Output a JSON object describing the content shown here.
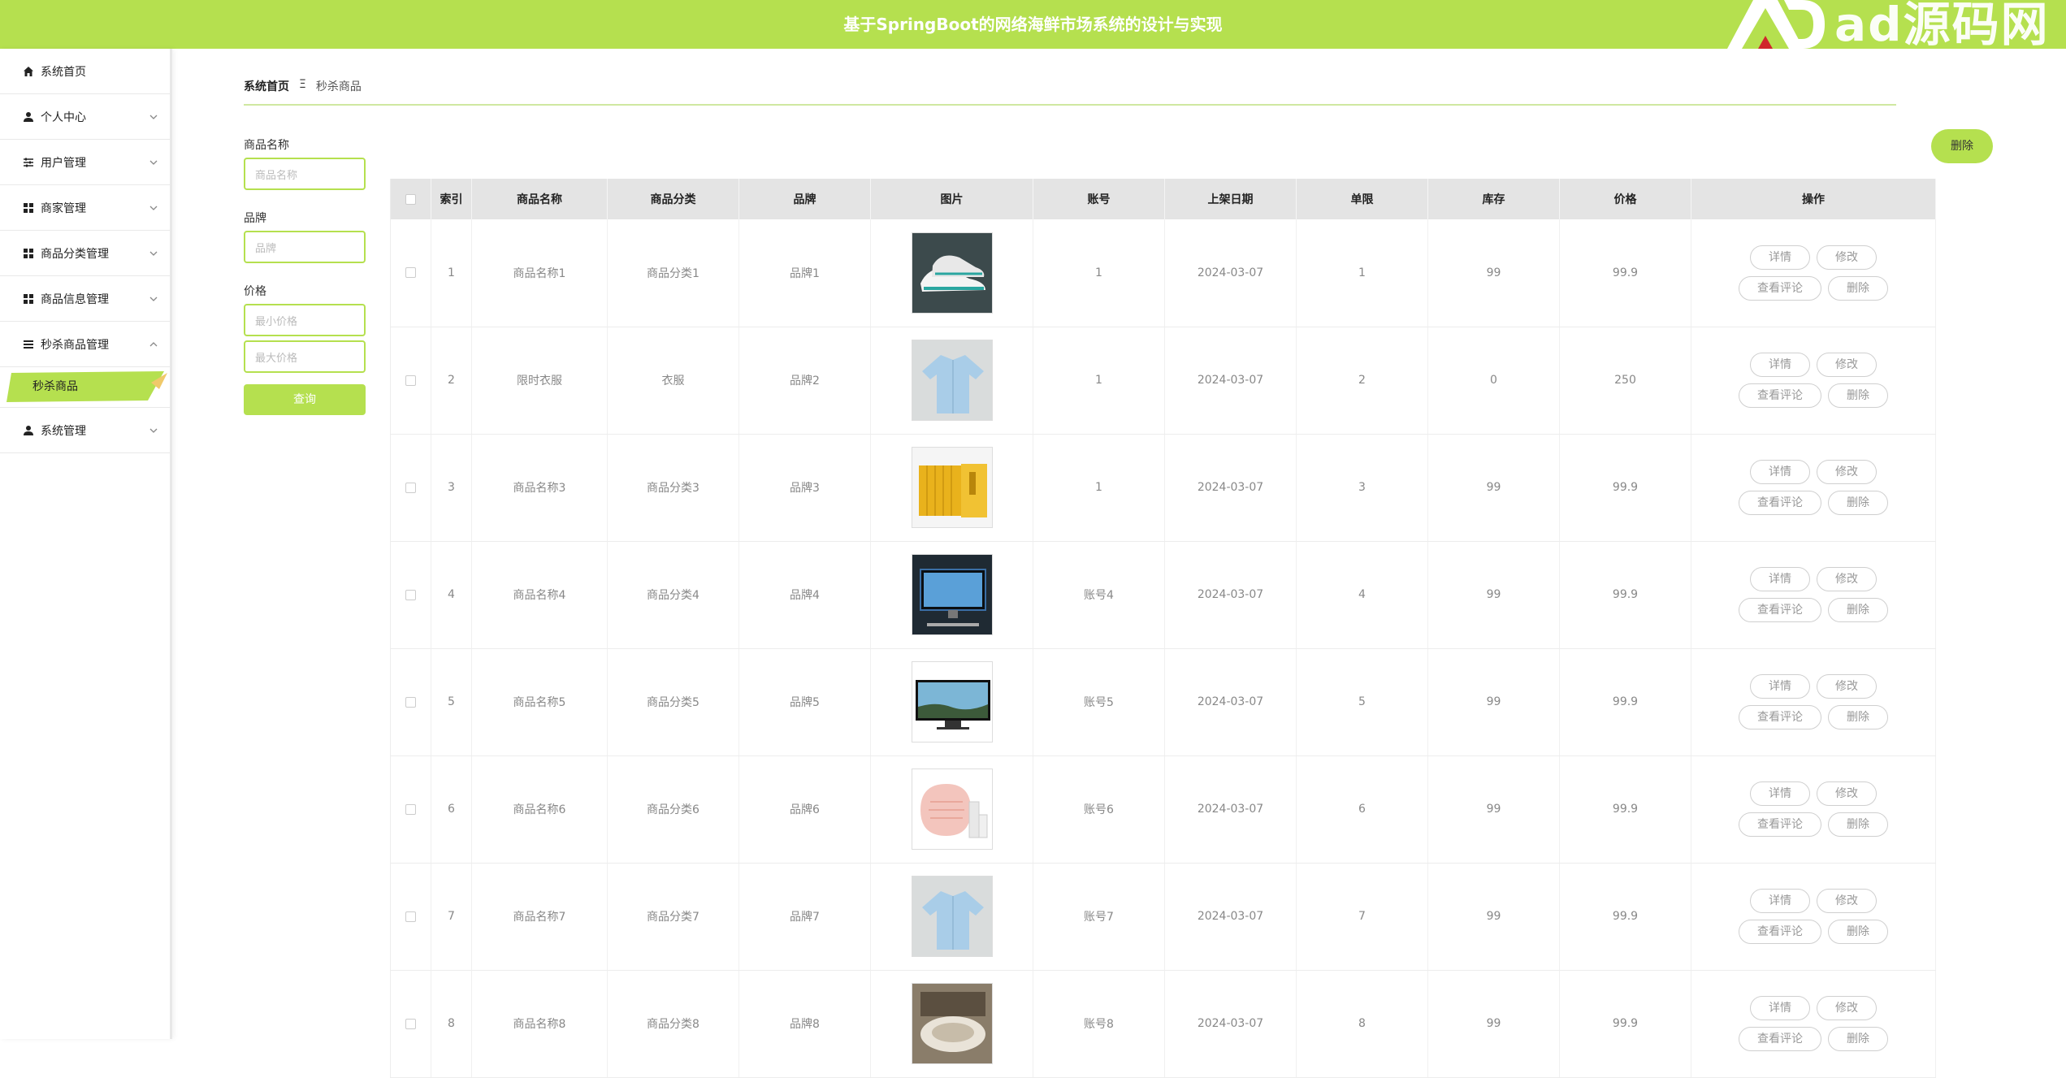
{
  "header": {
    "title": "基于SpringBoot的网络海鲜市场系统的设计与实现",
    "watermark": "ad源码网",
    "watermark_icon": "ad-logo-icon",
    "brand_color": "#b5e04f"
  },
  "sidebar": {
    "items": [
      {
        "label": "系统首页",
        "icon": "home-icon"
      },
      {
        "label": "个人中心",
        "icon": "user-icon"
      },
      {
        "label": "用户管理",
        "icon": "sliders-icon"
      },
      {
        "label": "商家管理",
        "icon": "grid-icon"
      },
      {
        "label": "商品分类管理",
        "icon": "grid-icon"
      },
      {
        "label": "商品信息管理",
        "icon": "grid-icon"
      },
      {
        "label": "秒杀商品管理",
        "icon": "list-icon"
      },
      {
        "label": "系统管理",
        "icon": "user-icon"
      }
    ],
    "active_sub": "秒杀商品"
  },
  "breadcrumb": {
    "home": "系统首页",
    "separator": "Ξ",
    "current": "秒杀商品"
  },
  "search": {
    "name_label": "商品名称",
    "name_placeholder": "商品名称",
    "brand_label": "品牌",
    "brand_placeholder": "品牌",
    "price_label": "价格",
    "min_placeholder": "最小价格",
    "max_placeholder": "最大价格",
    "query_button": "查询"
  },
  "toolbar": {
    "delete_button": "删除"
  },
  "table": {
    "headers": [
      "索引",
      "商品名称",
      "商品分类",
      "品牌",
      "图片",
      "账号",
      "上架日期",
      "单限",
      "库存",
      "价格",
      "操作"
    ],
    "actions": {
      "detail": "详情",
      "edit": "修改",
      "comments": "查看评论",
      "delete": "删除"
    },
    "rows": [
      {
        "index": "1",
        "name": "商品名称1",
        "category": "商品分类1",
        "brand": "品牌1",
        "image": "sneakers",
        "account": "1",
        "date": "2024-03-07",
        "limit": "1",
        "stock": "99",
        "price": "99.9"
      },
      {
        "index": "2",
        "name": "限时衣服",
        "category": "衣服",
        "brand": "品牌2",
        "image": "shirt",
        "account": "1",
        "date": "2024-03-07",
        "limit": "2",
        "stock": "0",
        "price": "250"
      },
      {
        "index": "3",
        "name": "商品名称3",
        "category": "商品分类3",
        "brand": "品牌3",
        "image": "books",
        "account": "1",
        "date": "2024-03-07",
        "limit": "3",
        "stock": "99",
        "price": "99.9"
      },
      {
        "index": "4",
        "name": "商品名称4",
        "category": "商品分类4",
        "brand": "品牌4",
        "image": "desktop",
        "account": "账号4",
        "date": "2024-03-07",
        "limit": "4",
        "stock": "99",
        "price": "99.9"
      },
      {
        "index": "5",
        "name": "商品名称5",
        "category": "商品分类5",
        "brand": "品牌5",
        "image": "monitor",
        "account": "账号5",
        "date": "2024-03-07",
        "limit": "5",
        "stock": "99",
        "price": "99.9"
      },
      {
        "index": "6",
        "name": "商品名称6",
        "category": "商品分类6",
        "brand": "品牌6",
        "image": "cosmetics",
        "account": "账号6",
        "date": "2024-03-07",
        "limit": "6",
        "stock": "99",
        "price": "99.9"
      },
      {
        "index": "7",
        "name": "商品名称7",
        "category": "商品分类7",
        "brand": "品牌7",
        "image": "shirt",
        "account": "账号7",
        "date": "2024-03-07",
        "limit": "7",
        "stock": "99",
        "price": "99.9"
      },
      {
        "index": "8",
        "name": "商品名称8",
        "category": "商品分类8",
        "brand": "品牌8",
        "image": "tableware",
        "account": "账号8",
        "date": "2024-03-07",
        "limit": "8",
        "stock": "99",
        "price": "99.9"
      }
    ]
  }
}
